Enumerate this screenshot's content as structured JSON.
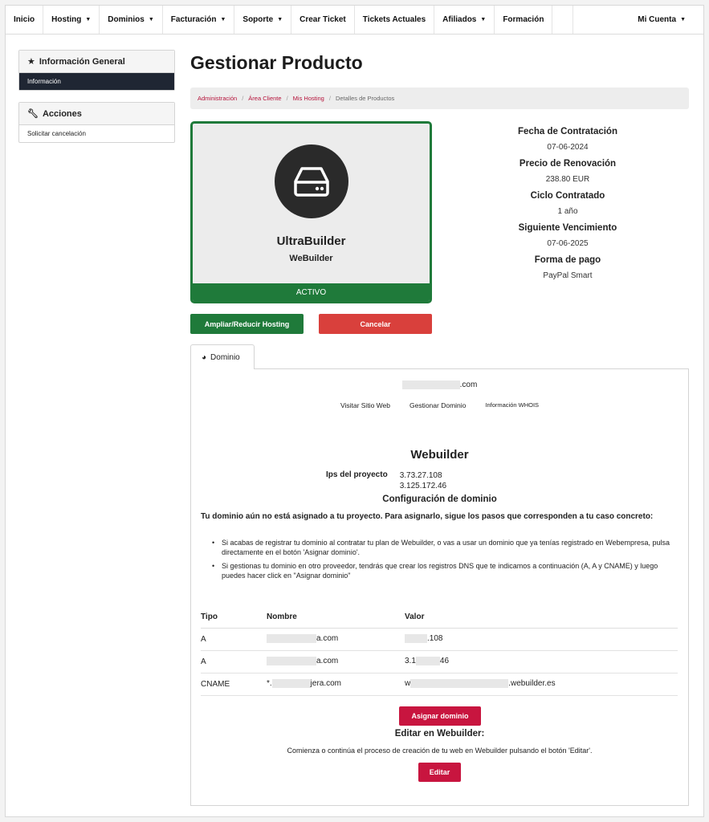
{
  "nav": {
    "items": [
      {
        "label": "Inicio",
        "dropdown": false
      },
      {
        "label": "Hosting",
        "dropdown": true
      },
      {
        "label": "Dominios",
        "dropdown": true
      },
      {
        "label": "Facturación",
        "dropdown": true
      },
      {
        "label": "Soporte",
        "dropdown": true
      },
      {
        "label": "Crear Ticket",
        "dropdown": false
      },
      {
        "label": "Tickets Actuales",
        "dropdown": false
      },
      {
        "label": "Afiliados",
        "dropdown": true
      },
      {
        "label": "Formación",
        "dropdown": false
      }
    ],
    "account": "Mi Cuenta"
  },
  "sidebar": {
    "info_panel": {
      "title": "Información General",
      "items": [
        "Información"
      ]
    },
    "actions_panel": {
      "title": "Acciones",
      "items": [
        "Solicitar cancelación"
      ]
    }
  },
  "page_title": "Gestionar Producto",
  "breadcrumb": {
    "links": [
      "Administración",
      "Área Cliente",
      "Mis Hosting"
    ],
    "current": "Detalles de Productos"
  },
  "product": {
    "name": "UltraBuilder",
    "subtitle": "WeBuilder",
    "status": "ACTIVO",
    "status_color": "#1f7a3a"
  },
  "details": [
    {
      "label": "Fecha de Contratación",
      "value": "07-06-2024"
    },
    {
      "label": "Precio de Renovación",
      "value": "238.80 EUR"
    },
    {
      "label": "Ciclo Contratado",
      "value": "1 año"
    },
    {
      "label": "Siguiente Vencimiento",
      "value": "07-06-2025"
    },
    {
      "label": "Forma de pago",
      "value": "PayPal Smart"
    }
  ],
  "buttons": {
    "upgrade": "Ampliar/Reducir Hosting",
    "cancel": "Cancelar",
    "assign_domain": "Asignar dominio",
    "edit": "Editar"
  },
  "tab": {
    "label": "Dominio"
  },
  "domain": {
    "suffix": ".com",
    "links": [
      "Visitar Sitio Web",
      "Gestionar Dominio",
      "Información WHOIS"
    ]
  },
  "webuilder": {
    "title": "Webuilder",
    "ips_label": "Ips del proyecto",
    "ips": [
      "3.73.27.108",
      "3.125.172.46"
    ],
    "config_title": "Configuración de dominio",
    "intro": "Tu dominio aún no está asignado a tu proyecto. Para asignarlo, sigue los pasos que corresponden a tu caso concreto:",
    "bullets": [
      "Si acabas de registrar tu dominio al contratar tu plan de Webuilder, o vas a usar un dominio que ya tenías registrado en Webempresa, pulsa directamente en el botón 'Asignar dominio'.",
      "Si gestionas tu dominio en otro proveedor, tendrás que crear los registros DNS que te indicamos a continuación (A, A y CNAME) y luego puedes hacer click en \"Asignar dominio\""
    ]
  },
  "dns_table": {
    "headers": [
      "Tipo",
      "Nombre",
      "Valor"
    ],
    "rows": [
      {
        "type": "A",
        "name_suffix": "a.com",
        "value_prefix": "",
        "value_suffix": ".108"
      },
      {
        "type": "A",
        "name_suffix": "a.com",
        "value_prefix": "3.1",
        "value_suffix": "46"
      },
      {
        "type": "CNAME",
        "name_prefix": "*.",
        "name_suffix": "jera.com",
        "value_prefix": "w",
        "value_suffix": ".webuilder.es"
      }
    ]
  },
  "edit_section": {
    "title": "Editar en Webuilder:",
    "description": "Comienza o continúa el proceso de creación de tu web en Webuilder pulsando el botón 'Editar'."
  }
}
